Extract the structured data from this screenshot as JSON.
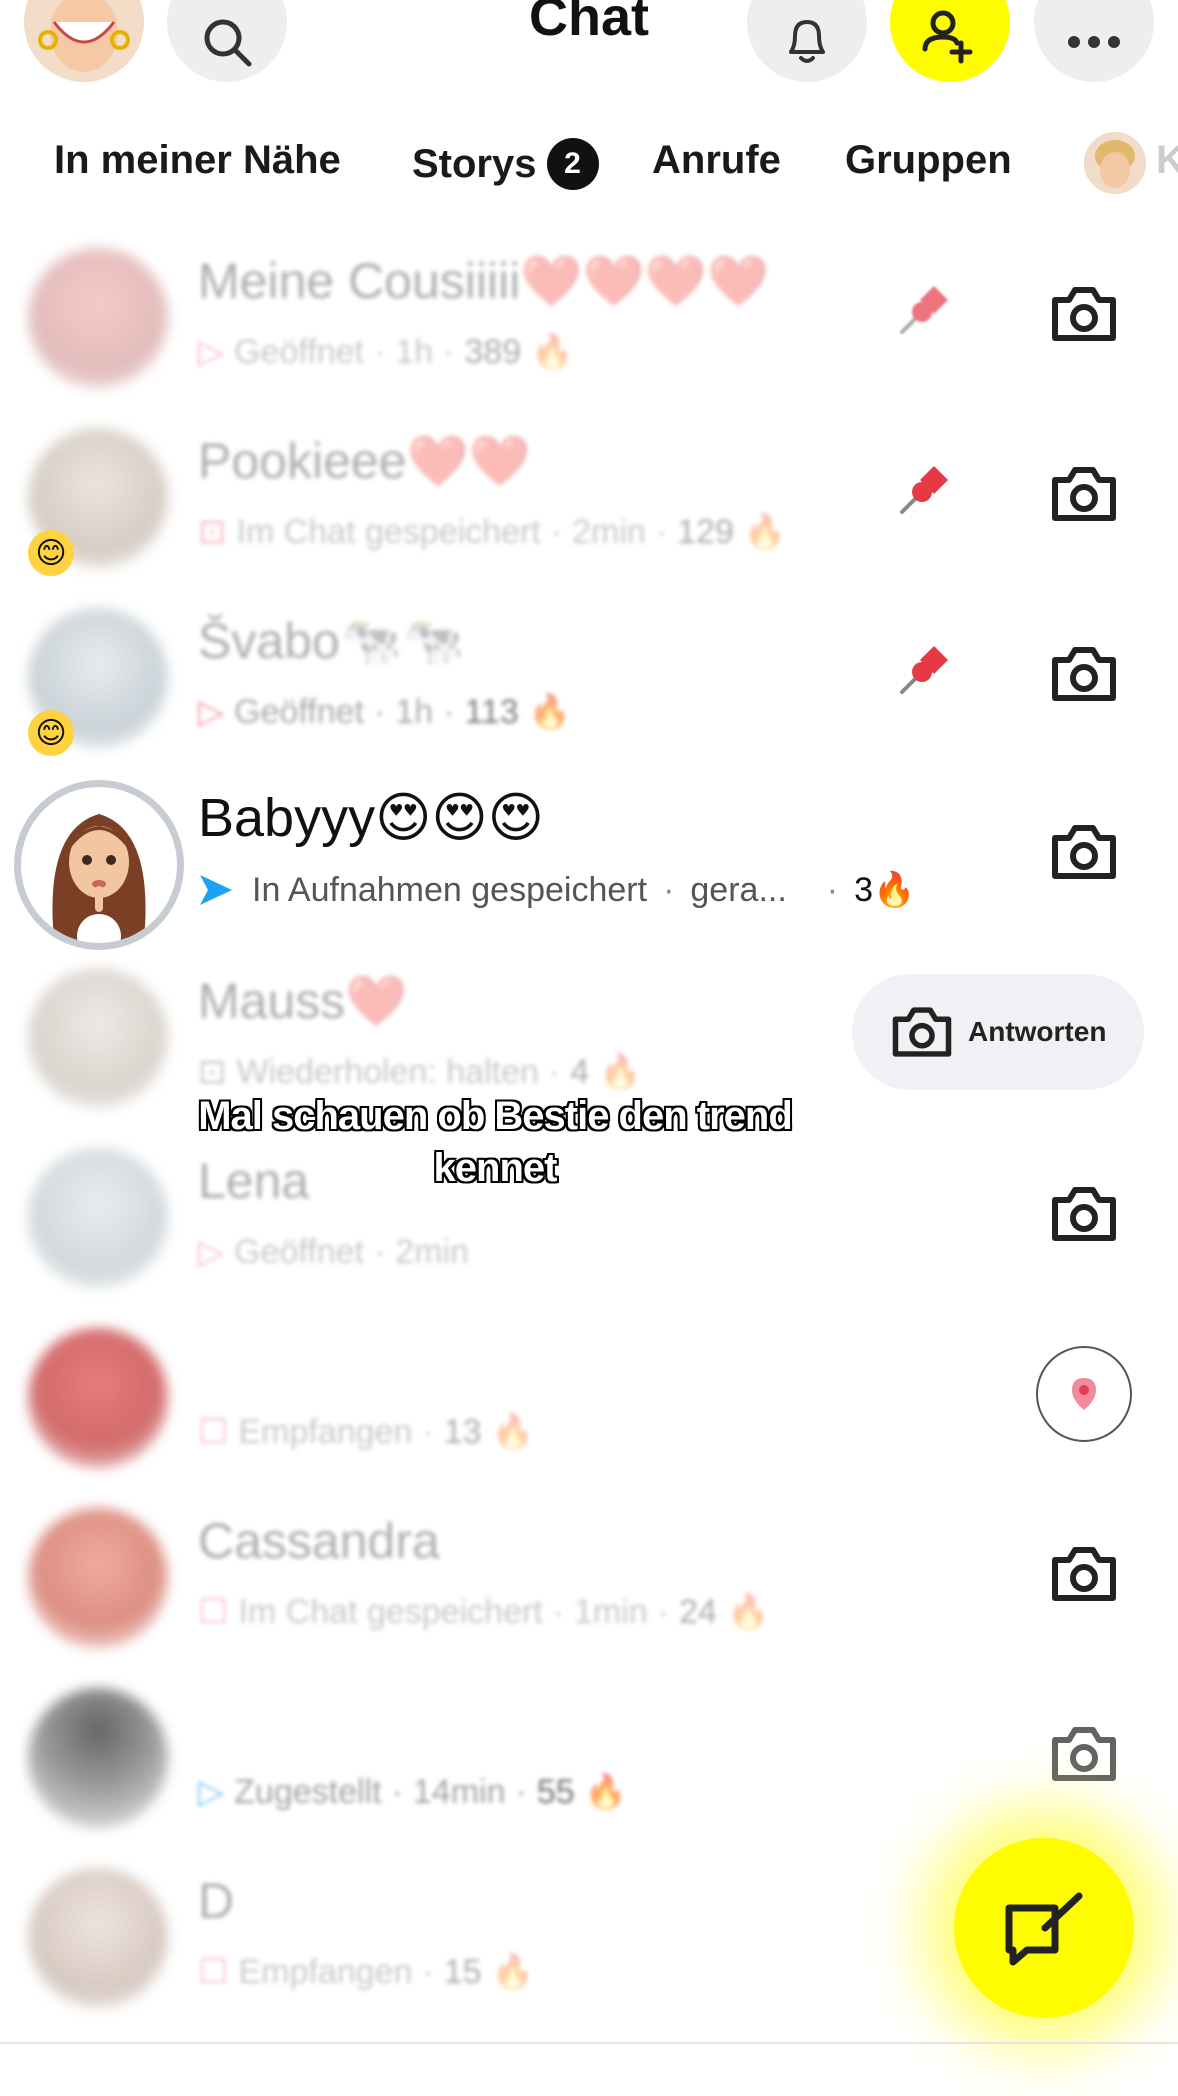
{
  "header": {
    "title": "Chat",
    "icons": [
      "avatar-icon",
      "search-icon",
      "bell-icon",
      "add-friend-icon",
      "more-icon"
    ]
  },
  "tabs": [
    {
      "label": "In meiner Nähe"
    },
    {
      "label": "Storys",
      "badge": "2"
    },
    {
      "label": "Anrufe"
    },
    {
      "label": "Gruppen"
    },
    {
      "label": "K"
    }
  ],
  "chats": [
    {
      "name": "Meine Cousiiiii❤️❤️❤️❤️",
      "status": "Geöffnet",
      "time": "1h",
      "streak": "389",
      "pinned": true,
      "blurred": true
    },
    {
      "name": "Pookieee❤️❤️",
      "status": "Im Chat gespeichert",
      "time": "2min",
      "streak": "129",
      "pinned": true,
      "blurred": true
    },
    {
      "name": "Švabo🐄🐄",
      "status": "Geöffnet",
      "time": "1h",
      "streak": "113",
      "pinned": true,
      "blurred": true
    },
    {
      "name": "Babyyy😍😍😍",
      "status": "In Aufnahmen gespeichert",
      "time": "gera...",
      "streak": "3",
      "pinned": false,
      "blurred": false
    },
    {
      "name": "Mauss❤️",
      "status": "Wiederholen: halten",
      "time": "",
      "streak": "4",
      "pinned": false,
      "blurred": true
    },
    {
      "name": "Lena",
      "status": "Geöffnet",
      "time": "2min",
      "streak": "",
      "pinned": false,
      "blurred": true
    },
    {
      "name": "",
      "status": "Empfangen",
      "time": "",
      "streak": "13",
      "pinned": false,
      "blurred": true
    },
    {
      "name": "Cassandra",
      "status": "Im Chat gespeichert",
      "time": "1min",
      "streak": "24",
      "pinned": false,
      "blurred": true
    },
    {
      "name": "",
      "status": "Zugestellt",
      "time": "14min",
      "streak": "55",
      "pinned": false,
      "blurred": true
    },
    {
      "name": "D",
      "status": "Empfangen",
      "time": "",
      "streak": "15",
      "pinned": false,
      "blurred": true
    }
  ],
  "reply_button": {
    "label": "Antworten"
  },
  "caption": {
    "text": "Mal schauen ob Bestie den trend kennet"
  },
  "fire_emoji": "🔥",
  "separator": "·",
  "colors": {
    "snap_yellow": "#fffc00",
    "send_blue": "#1da1f2",
    "sent_red": "#f23c57",
    "badge_black": "#111111"
  }
}
